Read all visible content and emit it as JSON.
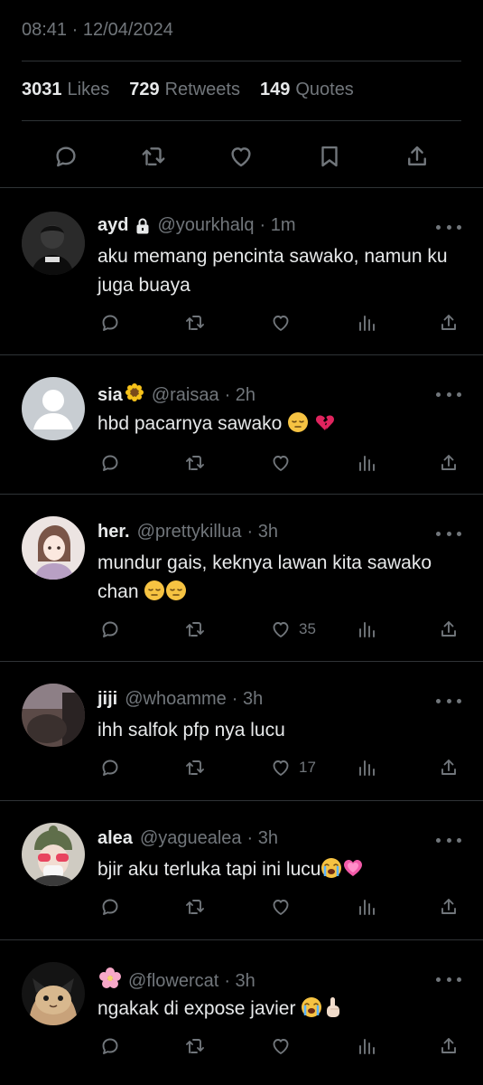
{
  "tweet": {
    "timestamp": "08:41 · 12/04/2024",
    "stats": [
      {
        "value": "3031",
        "label": "Likes"
      },
      {
        "value": "729",
        "label": "Retweets"
      },
      {
        "value": "149",
        "label": "Quotes"
      }
    ],
    "actions": [
      "reply-icon",
      "retweet-icon",
      "like-icon",
      "bookmark-icon",
      "share-icon"
    ]
  },
  "replies": [
    {
      "name": "ayd",
      "handle": "@yourkhalq",
      "time": "· 1m",
      "text": "aku memang pencinta sawako, namun ku juga buaya",
      "likes": "",
      "locked": true
    },
    {
      "name": "sia",
      "name_emoji": "sunflower",
      "handle": "@raisaa",
      "time": "· 2h",
      "text": "hbd pacarnya sawako",
      "text_emoji": [
        "pensive-face",
        "broken-heart"
      ],
      "likes": ""
    },
    {
      "name": "her.",
      "handle": "@prettykillua",
      "time": "· 3h",
      "text": "mundur gais, keknya lawan kita sawako chan",
      "text_emoji": [
        "pensive-face",
        "pensive-face"
      ],
      "likes": "35"
    },
    {
      "name": "jiji",
      "handle": "@whoamme",
      "time": "· 3h",
      "text": "ihh salfok pfp nya lucu",
      "likes": "17"
    },
    {
      "name": "alea",
      "handle": "@yaguealea",
      "time": "· 3h",
      "text": "bjir aku terluka tapi ini lucu",
      "text_emoji": [
        "loudly-crying-face",
        "growing-heart"
      ],
      "likes": ""
    },
    {
      "name": "",
      "name_emoji": "cherry-blossom",
      "handle": "@flowercat",
      "time": "· 3h",
      "text": "ngakak di expose javier",
      "text_emoji": [
        "loudly-crying-face",
        "pointing-up"
      ],
      "likes": ""
    }
  ],
  "colors": {
    "background": "#000000",
    "text": "#e7e9ea",
    "muted": "#71767b",
    "divider": "#2f3336"
  }
}
